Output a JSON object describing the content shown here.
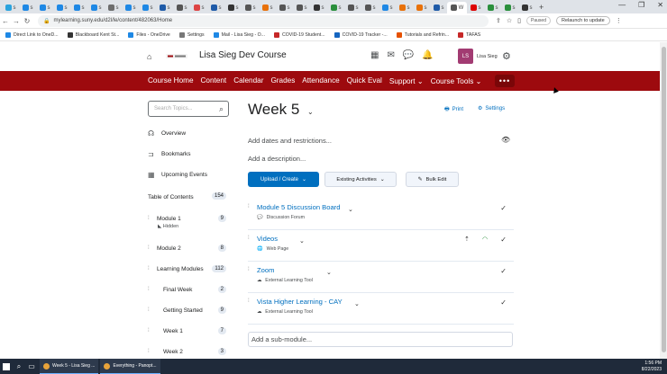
{
  "browser": {
    "tabs": [
      {
        "fav": "#2aa3de",
        "text": "s"
      },
      {
        "fav": "#1e88e5",
        "text": "s"
      },
      {
        "fav": "#1e88e5",
        "text": "s"
      },
      {
        "fav": "#1e88e5",
        "text": "s"
      },
      {
        "fav": "#1e88e5",
        "text": "s"
      },
      {
        "fav": "#1e88e5",
        "text": "s"
      },
      {
        "fav": "#6d6d6d",
        "text": "s"
      },
      {
        "fav": "#1e88e5",
        "text": "s"
      },
      {
        "fav": "#1e88e5",
        "text": "s"
      },
      {
        "fav": "#1e5aa8",
        "text": "s"
      },
      {
        "fav": "#555",
        "text": "s"
      },
      {
        "fav": "#d44",
        "text": "s"
      },
      {
        "fav": "#1e5aa8",
        "text": "s"
      },
      {
        "fav": "#333",
        "text": "s"
      },
      {
        "fav": "#555",
        "text": "s"
      },
      {
        "fav": "#e8710a",
        "text": "s"
      },
      {
        "fav": "#555",
        "text": "s"
      },
      {
        "fav": "#555",
        "text": "s"
      },
      {
        "fav": "#333",
        "text": "s"
      },
      {
        "fav": "#2a8f3c",
        "text": "s"
      },
      {
        "fav": "#555",
        "text": "s"
      },
      {
        "fav": "#555",
        "text": "s"
      },
      {
        "fav": "#1e88e5",
        "text": "s"
      },
      {
        "fav": "#e8710a",
        "text": "s"
      },
      {
        "fav": "#e8710a",
        "text": "s"
      },
      {
        "fav": "#1e5aa8",
        "text": "s"
      },
      {
        "fav": "#555",
        "text": "W"
      },
      {
        "fav": "#d00",
        "text": "s"
      },
      {
        "fav": "#2a8f3c",
        "text": "s"
      },
      {
        "fav": "#2a8f3c",
        "text": "s"
      },
      {
        "fav": "#333",
        "text": "s"
      }
    ],
    "new_tab": "+",
    "url": "mylearning.suny.edu/d2l/le/content/482063/Home",
    "paused_label": "Paused",
    "relaunch_label": "Relaunch to update",
    "bookmarks": [
      {
        "label": "Direct Link to OneD...",
        "color": "#1e88e5"
      },
      {
        "label": "Blackboard Kent St...",
        "color": "#333"
      },
      {
        "label": "Files - OneDrive",
        "color": "#1e88e5"
      },
      {
        "label": "Settings",
        "color": "#777"
      },
      {
        "label": "Mail - Lisa Sieg - O...",
        "color": "#1e88e5"
      },
      {
        "label": "COVID-19 Student...",
        "color": "#c62828"
      },
      {
        "label": "COVID-19 Tracker -...",
        "color": "#1565c0"
      },
      {
        "label": "Tutorials and Refrin...",
        "color": "#e65100"
      },
      {
        "label": "TAFAS",
        "color": "#c62828"
      }
    ]
  },
  "header": {
    "course_title": "Lisa Sieg Dev Course",
    "avatar_initials": "LS",
    "user_name": "Lisa Sieg"
  },
  "navbar": {
    "items": [
      "Course Home",
      "Content",
      "Calendar",
      "Grades",
      "Attendance",
      "Quick Eval",
      "Support ⌄",
      "Course Tools ⌄"
    ],
    "more": "•••"
  },
  "sidebar": {
    "search_placeholder": "Search Topics...",
    "links": [
      {
        "label": "Overview",
        "icon": "☊"
      },
      {
        "label": "Bookmarks",
        "icon": "⊐"
      },
      {
        "label": "Upcoming Events",
        "icon": "▦"
      }
    ],
    "toc_label": "Table of Contents",
    "toc_count": "154",
    "modules": [
      {
        "label": "Module 1",
        "count": "9",
        "sub": "Hidden"
      },
      {
        "label": "Module 2",
        "count": "8",
        "sub": ""
      },
      {
        "label": "Learning Modules",
        "count": "112",
        "sub": ""
      },
      {
        "label": "Final Week",
        "count": "2",
        "sub": ""
      },
      {
        "label": "Getting Started",
        "count": "9",
        "sub": ""
      },
      {
        "label": "Week 1",
        "count": "7",
        "sub": ""
      },
      {
        "label": "Week 2",
        "count": "3",
        "sub": ""
      }
    ]
  },
  "main": {
    "title": "Week 5",
    "print_label": "Print",
    "settings_label": "Settings",
    "add_dates": "Add dates and restrictions...",
    "add_description": "Add a description...",
    "upload_create": "Upload / Create",
    "existing_activities": "Existing Activities",
    "bulk_edit": "Bulk Edit",
    "topics": [
      {
        "title": "Module 5 Discussion Board",
        "type": "Discussion Forum"
      },
      {
        "title": "Videos",
        "type": "Web Page"
      },
      {
        "title": "Zoom",
        "type": "External Learning Tool"
      },
      {
        "title": "Vista Higher Learning - CAY",
        "type": "External Learning Tool"
      }
    ],
    "add_submodule": "Add a sub-module..."
  },
  "taskbar": {
    "apps": [
      "Week 5 - Lisa Sieg ...",
      "Everything - Panopt..."
    ],
    "time": "1:56 PM",
    "date": "8/22/2023"
  }
}
